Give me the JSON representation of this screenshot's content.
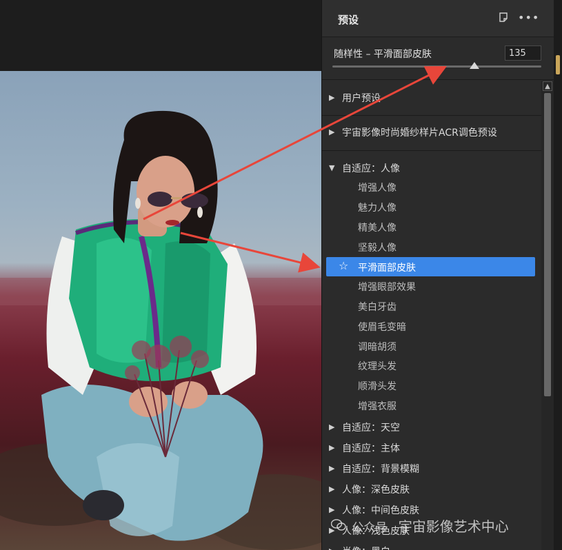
{
  "panel": {
    "title": "预设",
    "new_preset_icon": "new-preset-icon",
    "more_icon": "more-icon"
  },
  "amount": {
    "label": "随样性 – 平滑面部皮肤",
    "value": "135",
    "slider_fraction": 0.68
  },
  "groups_top": [
    {
      "label": "用户预设",
      "expanded": false
    },
    {
      "label": "宇宙影像时尚婚纱样片ACR调色预设",
      "expanded": false
    }
  ],
  "portrait_group": {
    "label": "自适应：人像",
    "expanded": true,
    "items": [
      "增强人像",
      "魅力人像",
      "精美人像",
      "坚毅人像",
      "平滑面部皮肤",
      "增强眼部效果",
      "美白牙齿",
      "使眉毛变暗",
      "调暗胡须",
      "纹理头发",
      "顺滑头发",
      "增强衣服"
    ],
    "selected_index": 4
  },
  "groups_bottom": [
    {
      "label": "自适应：天空"
    },
    {
      "label": "自适应：主体"
    },
    {
      "label": "自适应：背景模糊"
    },
    {
      "label": "人像：深色皮肤"
    },
    {
      "label": "人像：中间色皮肤"
    },
    {
      "label": "人像：浅色皮肤"
    },
    {
      "label": "肖像：黑白"
    }
  ],
  "watermark": {
    "icon": "wechat-icon",
    "small": "公众号",
    "main": "宇宙影像艺术中心"
  },
  "colors": {
    "selection": "#3b87e8",
    "arrow": "#e8463a",
    "panel_bg": "#2b2b2b"
  }
}
